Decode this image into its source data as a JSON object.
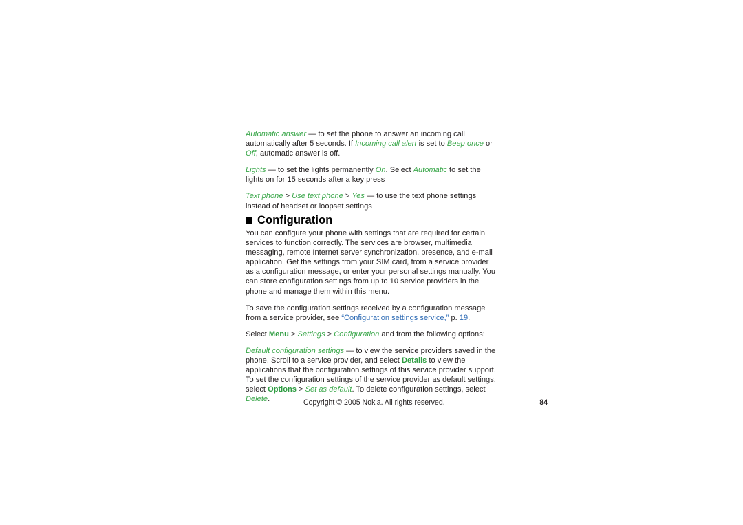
{
  "document": {
    "type": "user-guide-page",
    "page_number": "84",
    "colors": {
      "emphasis_green": "#3aa74a",
      "command_green": "#2e9c41",
      "link_blue": "#2f6cb5",
      "body_text": "#231f20",
      "background": "#ffffff"
    }
  },
  "settings_items": {
    "automatic_answer": {
      "term": "Automatic answer",
      "dash": " — ",
      "text_1": "to set the phone to answer an incoming call automatically after 5 seconds. If ",
      "term_2": "Incoming call alert",
      "text_2": " is set to ",
      "term_3": "Beep once",
      "text_3": " or ",
      "term_4": "Off",
      "text_4": ", automatic answer is off."
    },
    "lights": {
      "term": "Lights",
      "dash": " — ",
      "text_1": "to set the lights permanently ",
      "term_2": "On",
      "text_2": ". Select ",
      "term_3": "Automatic",
      "text_3": " to set the lights on for 15 seconds after a key press"
    },
    "text_phone": {
      "term": "Text phone",
      "sep_1": " > ",
      "term_2": "Use text phone",
      "sep_2": " > ",
      "term_3": "Yes",
      "dash": " — ",
      "text_1": "to use the text phone settings instead of headset or loopset settings"
    }
  },
  "section": {
    "bullet_icon": "filled-square-bullet",
    "title": "Configuration",
    "intro_paragraph": "You can configure your phone with settings that are required for certain services to function correctly. The services are browser, multimedia messaging, remote Internet server synchronization, presence, and e-mail application. Get the settings from your SIM card, from a service provider as a configuration message, or enter your personal settings manually. You can store configuration settings from up to 10 service providers in the phone and manage them within this menu.",
    "cross_reference": {
      "text_before": "To save the configuration settings received by a configuration message from a service provider, see ",
      "quote_open": "“",
      "link_text": "Configuration settings service,",
      "quote_close": "”",
      "text_mid": " p. ",
      "link_page": "19",
      "text_after": "."
    },
    "menu_path": {
      "text_before": "Select ",
      "item_1": "Menu",
      "sep_1": " > ",
      "item_2": "Settings",
      "sep_2": " > ",
      "item_3": "Configuration",
      "text_after": " and from the following options:"
    },
    "default_config": {
      "term": "Default configuration settings",
      "dash": " — ",
      "text_1": "to view the service providers saved in the phone. Scroll to a service provider, and select ",
      "command_1": "Details",
      "text_2": " to view the applications that the configuration settings of this service provider support. To set the configuration settings of the service provider as default settings, select ",
      "command_2": "Options",
      "sep_1": " > ",
      "term_2": "Set as default",
      "text_3": ". To delete configuration settings, select ",
      "term_3": "Delete",
      "text_4": "."
    }
  },
  "footer": {
    "copyright": "Copyright © 2005 Nokia. All rights reserved.",
    "page_number": "84"
  }
}
